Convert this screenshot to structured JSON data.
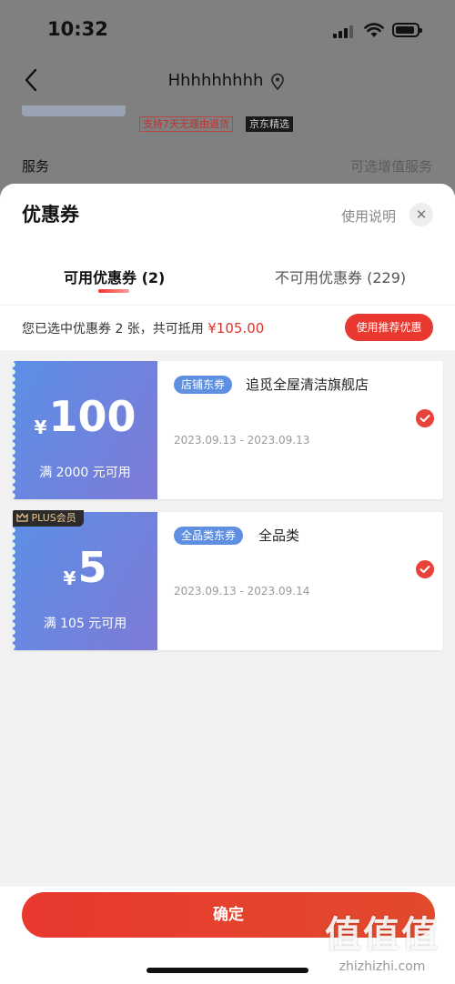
{
  "status": {
    "time": "10:32"
  },
  "nav": {
    "title": "Hhhhhhhhh"
  },
  "behind": {
    "tag_return": "支持7天无理由退货",
    "tag_jx": "京东精选",
    "service_label": "服务",
    "service_value": "可选增值服务"
  },
  "sheet": {
    "title": "优惠券",
    "help": "使用说明",
    "close": "✕"
  },
  "tabs": [
    {
      "label": "可用优惠券 (2)"
    },
    {
      "label": "不可用优惠券 (229)"
    }
  ],
  "summary": {
    "text": "您已选中优惠券 2 张，共可抵用 ",
    "amount": "¥105.00",
    "recommend_button": "使用推荐优惠"
  },
  "coupons": [
    {
      "currency": "¥",
      "amount": "100",
      "condition": "满 2000 元可用",
      "type": "店铺东券",
      "scope": "追觅全屋清洁旗舰店",
      "dates": "2023.09.13 - 2023.09.13",
      "selected": true
    },
    {
      "badge": "PLUS会员",
      "currency": "¥",
      "amount": "5",
      "condition": "满 105 元可用",
      "type": "全品类东券",
      "scope": "全品类",
      "dates": "2023.09.13 - 2023.09.14",
      "selected": true
    }
  ],
  "footer": {
    "confirm": "确定"
  },
  "watermark": {
    "logo": "值值值",
    "site": "zhizhizhi.com"
  },
  "colors": {
    "accent": "#e8382f",
    "coupon_blue": "#5b8fe6"
  }
}
